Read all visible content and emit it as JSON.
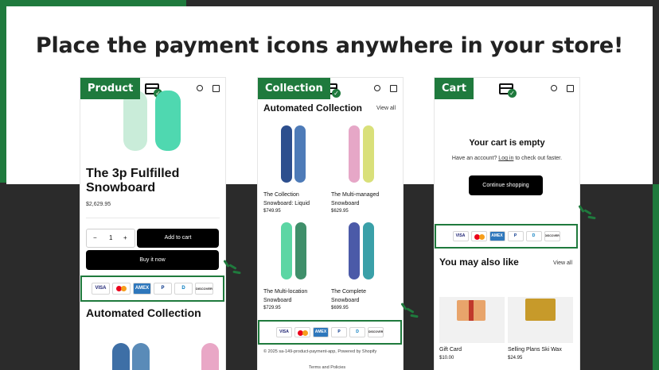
{
  "headline": "Place the payment icons anywhere in your store!",
  "colors": {
    "brand_green": "#1f7a3d",
    "background_dark": "#2b2b2b"
  },
  "icons": [
    "card-check-logo-icon",
    "user-icon",
    "bag-icon",
    "minus-icon",
    "plus-icon",
    "sparkle-icon"
  ],
  "payment_icons": [
    "VISA",
    "Mastercard",
    "AMEX",
    "P",
    "D",
    "DISCOVER"
  ],
  "product_panel": {
    "tag": "Product",
    "title": "The 3p Fulfilled Snowboard",
    "price": "$2,629.95",
    "quantity": "1",
    "minus": "−",
    "plus": "+",
    "add_to_cart": "Add to cart",
    "buy_now": "Buy it now",
    "section_heading": "Automated Collection"
  },
  "collection_panel": {
    "tag": "Collection",
    "heading": "Automated Collection",
    "view_all": "View all",
    "items": [
      {
        "name": "The Collection Snowboard: Liquid",
        "price": "$749.95"
      },
      {
        "name": "The Multi-managed Snowboard",
        "price": "$629.95"
      },
      {
        "name": "The Multi-location Snowboard",
        "price": "$729.95"
      },
      {
        "name": "The Complete Snowboard",
        "price": "$699.95"
      }
    ],
    "footer": "© 2025 sa-149-product-payment-app, Powered by Shopify",
    "footer_link": "Terms and Policies"
  },
  "cart_panel": {
    "tag": "Cart",
    "title": "Your cart is empty",
    "subtitle_pre": "Have an account? ",
    "login": "Log in",
    "subtitle_post": " to check out faster.",
    "continue": "Continue shopping",
    "also_like": "You may also like",
    "view_all": "View all",
    "products": [
      {
        "name": "Gift Card",
        "price": "$10.00"
      },
      {
        "name": "Selling Plans Ski Wax",
        "price": "$24.95"
      }
    ]
  }
}
